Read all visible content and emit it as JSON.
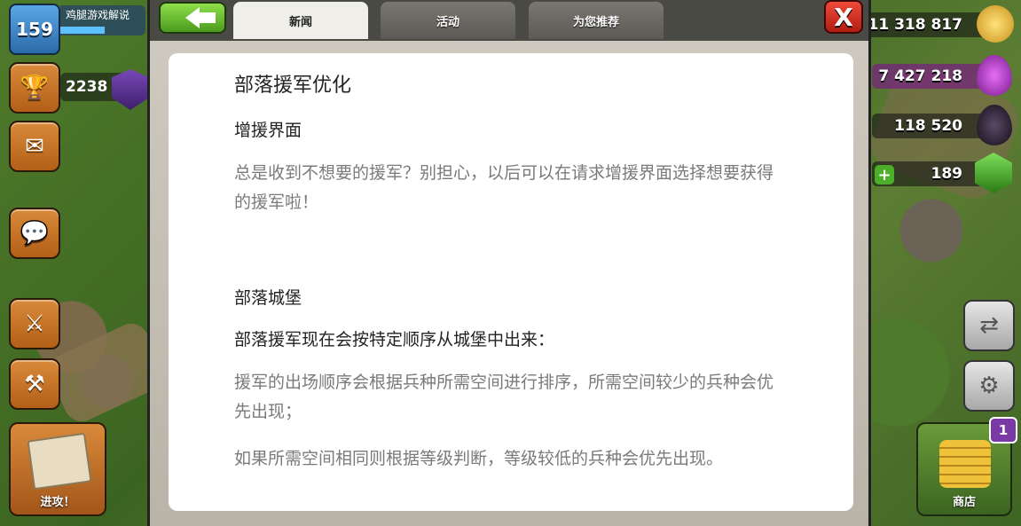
{
  "player": {
    "level": "159",
    "name": "鸡腿游戏解说",
    "trophies": "2238"
  },
  "resources": {
    "gold": "11 318 817",
    "elixir": "7 427 218",
    "dark_elixir": "118 520",
    "gems": "189"
  },
  "left_hud": {
    "attack_label": "进攻！"
  },
  "right_hud": {
    "shop_label": "商店",
    "shop_badge": "1"
  },
  "modal": {
    "tabs": [
      {
        "label": "新闻",
        "active": true
      },
      {
        "label": "活动",
        "active": false
      },
      {
        "label": "为您推荐",
        "active": false
      }
    ],
    "close_label": "X"
  },
  "article": {
    "title": "部落援军优化",
    "section1_heading": "增援界面",
    "section1_body": "总是收到不想要的援军？别担心，以后可以在请求增援界面选择想要获得的援军啦！",
    "section2_heading": "部落城堡",
    "section2_subheading": "部落援军现在会按特定顺序从城堡中出来：",
    "section2_body1": "援军的出场顺序会根据兵种所需空间进行排序，所需空间较少的兵种会优先出现；",
    "section2_body2": "如果所需空间相同则根据等级判断，等级较低的兵种会优先出现。"
  },
  "colors": {
    "gold": "#f0c23a",
    "elixir": "#b23ac8",
    "dark_elixir": "#2a2230",
    "gems": "#4caf2a",
    "close_red": "#d82a1e",
    "back_green": "#6cc332"
  }
}
